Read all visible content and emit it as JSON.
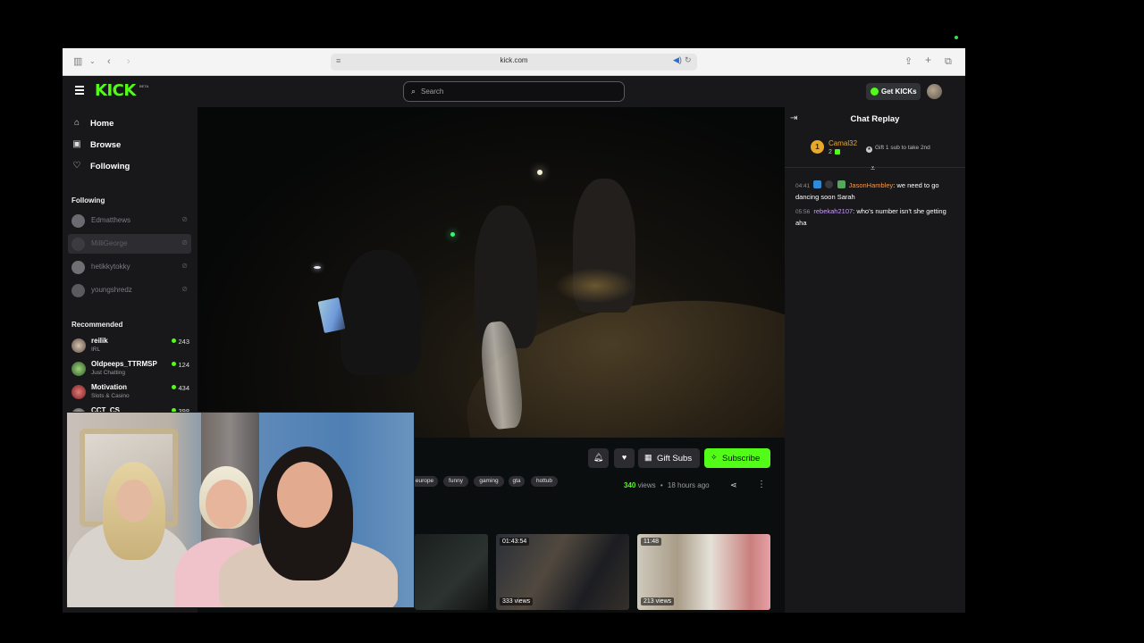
{
  "browser": {
    "url": "kick.com"
  },
  "header": {
    "logo": "KICK",
    "logo_badge": "BETA",
    "search_placeholder": "Search",
    "get_kicks_label": "Get KICKs"
  },
  "sidebar": {
    "nav": [
      {
        "label": "Home",
        "icon": "home-icon"
      },
      {
        "label": "Browse",
        "icon": "browse-icon"
      },
      {
        "label": "Following",
        "icon": "heart-icon"
      }
    ],
    "following_title": "Following",
    "following": [
      {
        "name": "Edmatthews"
      },
      {
        "name": "MilliGeorge"
      },
      {
        "name": "hetikkytokky"
      },
      {
        "name": "youngshredz"
      }
    ],
    "recommended_title": "Recommended",
    "recommended": [
      {
        "name": "reilik",
        "category": "IRL",
        "viewers": "243"
      },
      {
        "name": "Oldpeeps_TTRMSP",
        "category": "Just Chatting",
        "viewers": "124"
      },
      {
        "name": "Motivation",
        "category": "Slots & Casino",
        "viewers": "434"
      },
      {
        "name": "CCT_CS",
        "category": "",
        "viewers": "398"
      }
    ]
  },
  "stream_info": {
    "gift_label": "Gift Subs",
    "subscribe_label": "Subscribe",
    "tags": [
      "europe",
      "funny",
      "gaming",
      "gta",
      "hottub"
    ],
    "views_count": "340",
    "views_label": "views",
    "separator": "•",
    "time_ago": "18 hours ago"
  },
  "vods": [
    {
      "duration": "",
      "views": ""
    },
    {
      "duration": "01:43:54",
      "views": "333 views"
    },
    {
      "duration": "11:48",
      "views": "213 views"
    }
  ],
  "chat": {
    "title": "Chat Replay",
    "pinned": {
      "rank": "1",
      "user": "Camal32",
      "count": "2",
      "gift_text": "Gift 1 sub to take 2nd"
    },
    "messages": [
      {
        "time": "04:41",
        "user": "JasonHambley",
        "text": ": we need to go dancing soon Sarah"
      },
      {
        "time": "05:56",
        "user": "rebekah2107",
        "text": ": who's number isn't she getting aha"
      }
    ]
  },
  "colors": {
    "accent": "#53fc18",
    "panel": "#18181b",
    "background": "#0b0e0f"
  }
}
